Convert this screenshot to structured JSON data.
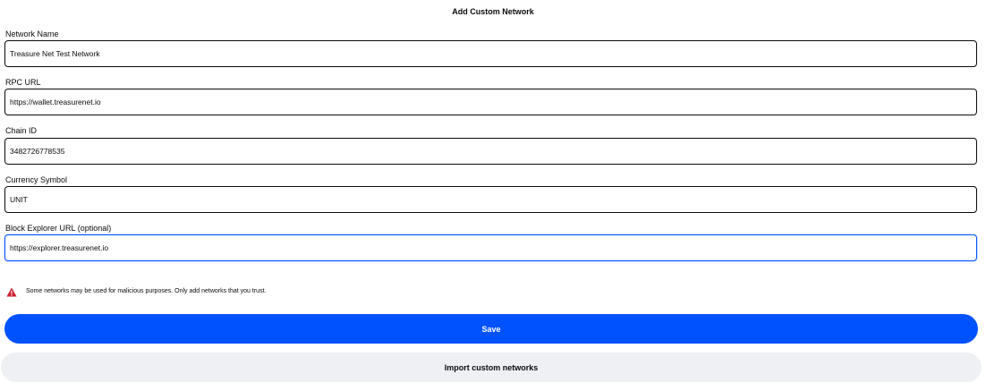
{
  "header": {
    "title": "Add Custom Network"
  },
  "form": {
    "network_name": {
      "label": "Network Name",
      "value": "Treasure Net Test Network"
    },
    "rpc_url": {
      "label": "RPC URL",
      "value": "https://wallet.treasurenet.io"
    },
    "chain_id": {
      "label": "Chain ID",
      "value": "3482726778535"
    },
    "currency_symbol": {
      "label": "Currency Symbol",
      "value": "UNIT"
    },
    "block_explorer_url": {
      "label": "Block Explorer URL (optional)",
      "value": "https://explorer.treasurenet.io"
    }
  },
  "warning": {
    "icon": "warning-triangle-icon",
    "text": "Some networks may be used for malicious purposes. Only add networks that you trust.",
    "color": "#cf202f"
  },
  "actions": {
    "save_label": "Save",
    "import_label": "Import custom networks"
  },
  "colors": {
    "primary": "#0052ff",
    "secondary_bg": "#eef0f3",
    "text": "#0a0b0d"
  }
}
